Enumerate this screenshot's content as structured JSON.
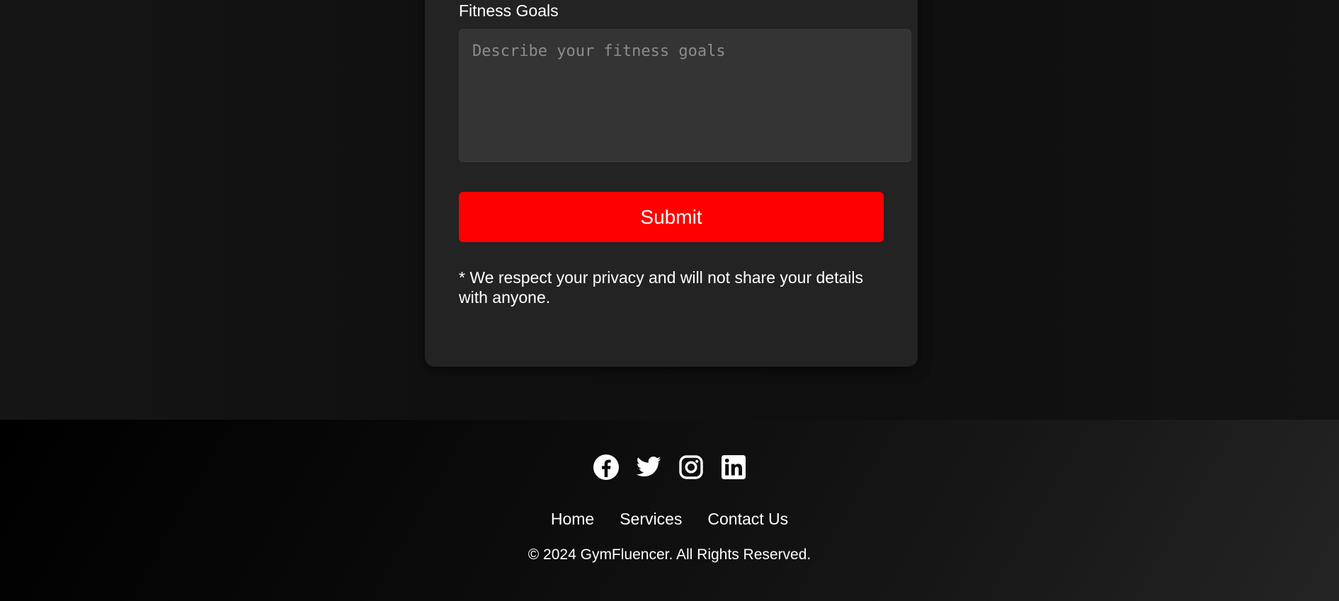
{
  "form": {
    "fitness_goals_label": "Fitness Goals",
    "fitness_goals_placeholder": "Describe your fitness goals",
    "fitness_goals_value": "",
    "submit_label": "Submit",
    "privacy_note": "* We respect your privacy and will not share your details with anyone."
  },
  "footer": {
    "social": [
      {
        "name": "facebook-icon"
      },
      {
        "name": "twitter-icon"
      },
      {
        "name": "instagram-icon"
      },
      {
        "name": "linkedin-icon"
      }
    ],
    "nav": [
      "Home",
      "Services",
      "Contact Us"
    ],
    "copyright": "© 2024 GymFluencer. All Rights Reserved."
  },
  "colors": {
    "accent": "#ff0000",
    "card_background": "#232323",
    "input_background": "#343434",
    "text": "#ffffff"
  }
}
